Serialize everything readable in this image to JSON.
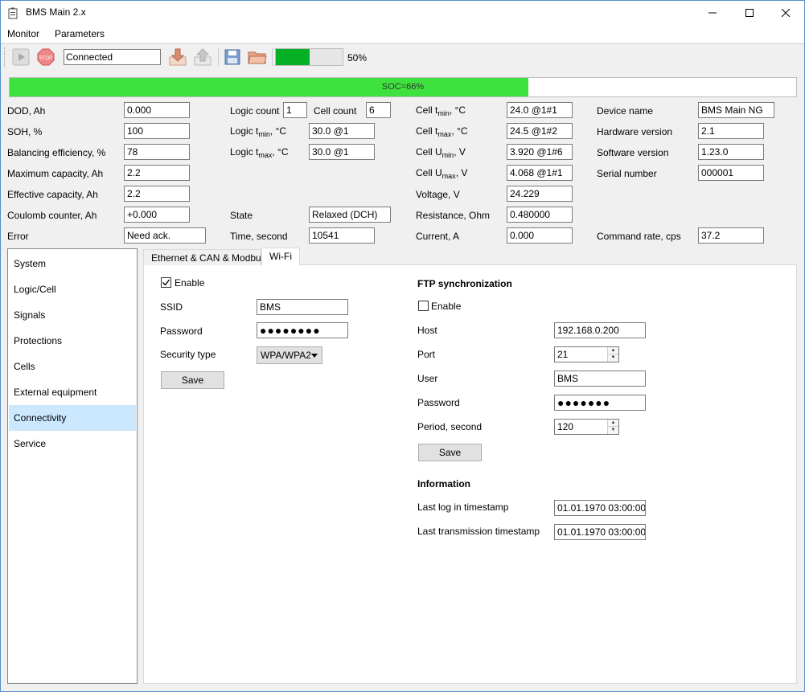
{
  "window": {
    "title": "BMS Main 2.x"
  },
  "menu": {
    "items": [
      "Monitor",
      "Parameters"
    ]
  },
  "toolbar": {
    "status": "Connected",
    "progress_percent": 50,
    "progress_label": "50%"
  },
  "soc": {
    "label": "SOC=66%",
    "percent": 66
  },
  "info": {
    "dod_label": "DOD, Ah",
    "dod_value": "0.000",
    "soh_label": "SOH, %",
    "soh_value": "100",
    "bal_label": "Balancing efficiency, %",
    "bal_value": "78",
    "maxcap_label": "Maximum capacity, Ah",
    "maxcap_value": "2.2",
    "effcap_label": "Effective capacity, Ah",
    "effcap_value": "2.2",
    "coulomb_label": "Coulomb counter, Ah",
    "coulomb_value": "+0.000",
    "error_label": "Error",
    "error_value": "Need ack.",
    "logic_count_label": "Logic count",
    "logic_count_value": "1",
    "cell_count_label": "Cell count",
    "cell_count_value": "6",
    "logic_tmin_prefix": "Logic t",
    "logic_tmin_sub": "min",
    "logic_tmin_suffix": ", °C",
    "logic_tmin_value": "30.0 @1",
    "logic_tmax_prefix": "Logic t",
    "logic_tmax_sub": "max",
    "logic_tmax_suffix": ", °C",
    "logic_tmax_value": "30.0 @1",
    "state_label": "State",
    "state_value": "Relaxed (DCH)",
    "time_label": "Time, second",
    "time_value": "10541",
    "cell_tmin_prefix": "Cell t",
    "cell_tmin_sub": "min",
    "cell_tmin_suffix": ", °C",
    "cell_tmin_value": "24.0 @1#1",
    "cell_tmax_prefix": "Cell t",
    "cell_tmax_sub": "max",
    "cell_tmax_suffix": ", °C",
    "cell_tmax_value": "24.5 @1#2",
    "cell_umin_prefix": "Cell U",
    "cell_umin_sub": "min",
    "cell_umin_suffix": ", V",
    "cell_umin_value": "3.920 @1#6",
    "cell_umax_prefix": "Cell U",
    "cell_umax_sub": "max",
    "cell_umax_suffix": ", V",
    "cell_umax_value": "4.068 @1#1",
    "voltage_label": "Voltage, V",
    "voltage_value": "24.229",
    "resistance_label": "Resistance, Ohm",
    "resistance_value": "0.480000",
    "current_label": "Current, A",
    "current_value": "0.000",
    "device_name_label": "Device name",
    "device_name_value": "BMS Main NG",
    "hw_label": "Hardware version",
    "hw_value": "2.1",
    "sw_label": "Software version",
    "sw_value": "1.23.0",
    "serial_label": "Serial number",
    "serial_value": "000001",
    "cmdrate_label": "Command rate, cps",
    "cmdrate_value": "37.2"
  },
  "sidebar": {
    "items": [
      {
        "label": "System"
      },
      {
        "label": "Logic/Cell"
      },
      {
        "label": "Signals"
      },
      {
        "label": "Protections"
      },
      {
        "label": "Cells"
      },
      {
        "label": "External equipment"
      },
      {
        "label": "Connectivity"
      },
      {
        "label": "Service"
      }
    ],
    "selected": "Connectivity"
  },
  "tabs": [
    {
      "label": "Ethernet & CAN & Modbus"
    },
    {
      "label": "Wi-Fi"
    }
  ],
  "wifi": {
    "enable_label": "Enable",
    "enable_checked": true,
    "ssid_label": "SSID",
    "ssid_value": "BMS",
    "password_label": "Password",
    "password_value": "●●●●●●●●",
    "security_label": "Security type",
    "security_value": "WPA/WPA2",
    "save_label": "Save"
  },
  "ftp": {
    "title": "FTP synchronization",
    "enable_label": "Enable",
    "enable_checked": false,
    "host_label": "Host",
    "host_value": "192.168.0.200",
    "port_label": "Port",
    "port_value": "21",
    "user_label": "User",
    "user_value": "BMS",
    "password_label": "Password",
    "password_value": "●●●●●●●",
    "period_label": "Period, second",
    "period_value": "120",
    "save_label": "Save"
  },
  "information": {
    "title": "Information",
    "last_log_label": "Last log in timestamp",
    "last_log_value": "01.01.1970 03:00:00",
    "last_tx_label": "Last transmission timestamp",
    "last_tx_value": "01.01.1970 03:00:00"
  }
}
